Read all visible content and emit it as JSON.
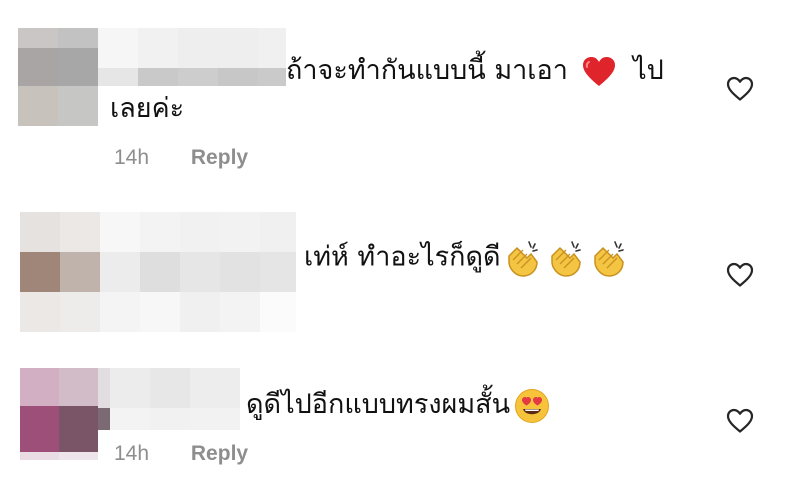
{
  "comments": [
    {
      "text_line1": "ถ้าจะทำกันแบบนี้ มาเอา",
      "text_after_emoji": "ไป",
      "text_line2": "เลยค่ะ",
      "emoji": "red-heart",
      "time": "14h",
      "reply": "Reply",
      "like_icon": "heart-outline-icon"
    },
    {
      "text_line1": "เท่ห์ ทำอะไรก็ดูดี",
      "emoji": "clapping-hands",
      "like_icon": "heart-outline-icon"
    },
    {
      "text_line1": "ดูดีไปอีกแบบทรงผมสั้น",
      "emoji": "smiling-face-with-heart-eyes",
      "time": "14h",
      "reply": "Reply",
      "like_icon": "heart-outline-icon"
    }
  ],
  "colors": {
    "meta_text": "#8e8e8e",
    "comment_text": "#111111",
    "heart_red": "#e0242b",
    "icon_outline": "#262626"
  }
}
